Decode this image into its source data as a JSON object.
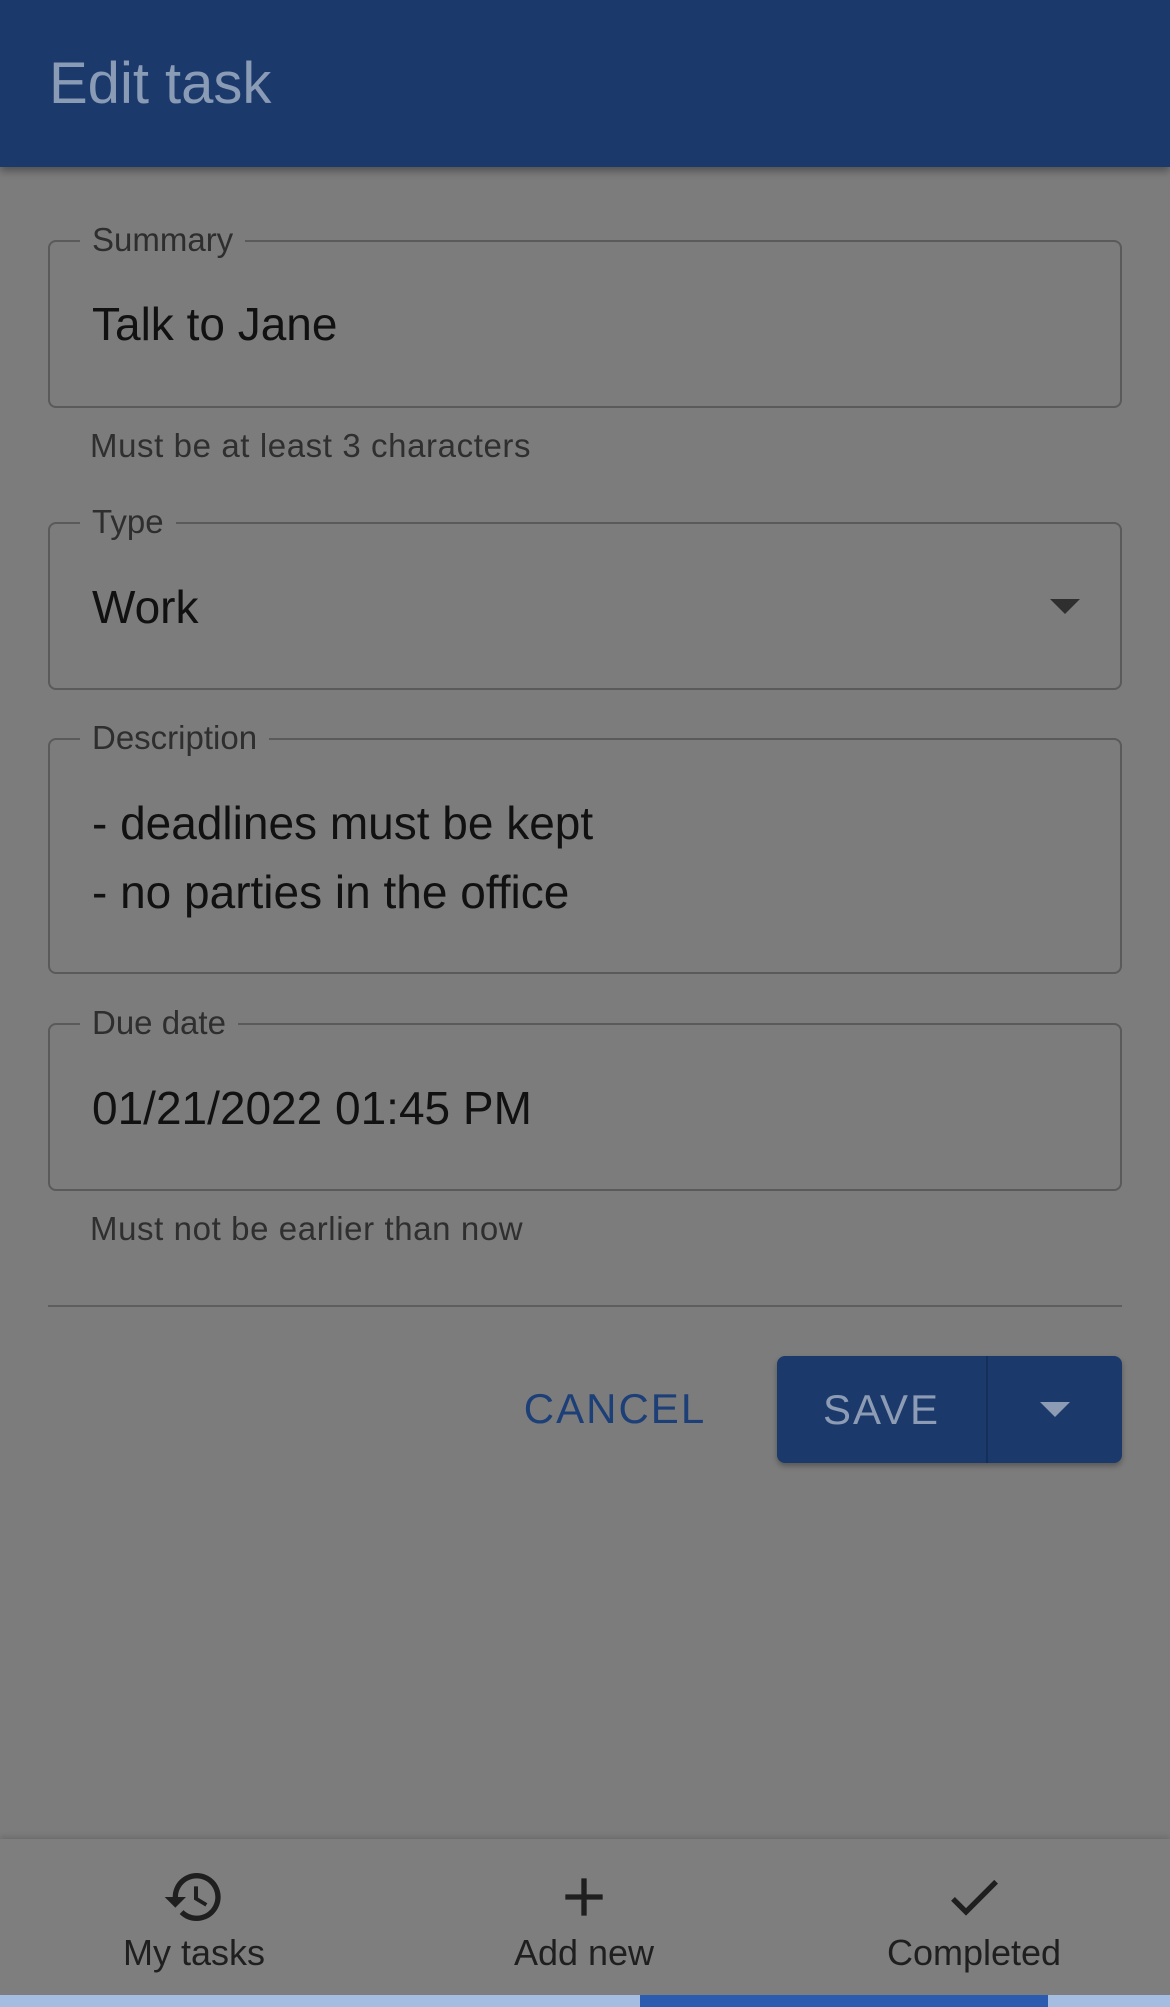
{
  "header": {
    "title": "Edit task"
  },
  "form": {
    "summary": {
      "label": "Summary",
      "value": "Talk to Jane",
      "helper": "Must be at least 3 characters"
    },
    "type": {
      "label": "Type",
      "value": "Work"
    },
    "description": {
      "label": "Description",
      "lines": [
        "- deadlines must be kept",
        "- no parties in the office"
      ]
    },
    "due_date": {
      "label": "Due date",
      "value": "01/21/2022 01:45 PM",
      "helper": "Must not be earlier than now"
    }
  },
  "actions": {
    "cancel_label": "CANCEL",
    "save_label": "SAVE"
  },
  "bottom_nav": {
    "items": [
      {
        "label": "My tasks",
        "icon": "history-icon"
      },
      {
        "label": "Add new",
        "icon": "plus-icon"
      },
      {
        "label": "Completed",
        "icon": "check-icon"
      }
    ]
  },
  "colors": {
    "app_bar": "#1b3a6b",
    "scrim_background": "#7c7c7c",
    "accent": "#2b5caf"
  }
}
